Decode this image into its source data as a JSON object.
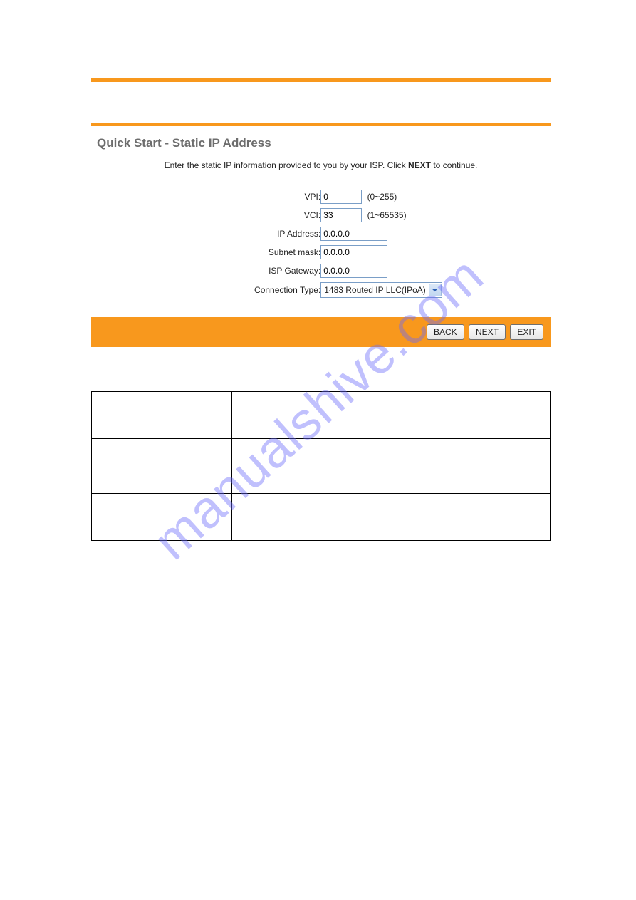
{
  "watermark": "manualshive.com",
  "panel": {
    "title": "Quick Start - Static IP Address",
    "desc_pre": "Enter the static IP information provided to you by your ISP. Click ",
    "desc_bold": "NEXT",
    "desc_post": " to continue."
  },
  "fields": {
    "vpi": {
      "label": "VPI:",
      "value": "0",
      "hint": "(0~255)"
    },
    "vci": {
      "label": "VCI:",
      "value": "33",
      "hint": "(1~65535)"
    },
    "ip": {
      "label": "IP Address:",
      "value": "0.0.0.0"
    },
    "mask": {
      "label": "Subnet mask:",
      "value": "0.0.0.0"
    },
    "gw": {
      "label": "ISP Gateway:",
      "value": "0.0.0.0"
    },
    "ct": {
      "label": "Connection Type:",
      "value": "1483 Routed IP LLC(IPoA)"
    }
  },
  "buttons": {
    "back": "BACK",
    "next": "NEXT",
    "exit": "EXIT"
  },
  "table": {
    "rows": [
      {
        "c1": "",
        "c2": ""
      },
      {
        "c1": "",
        "c2": ""
      },
      {
        "c1": "",
        "c2": ""
      },
      {
        "c1": "",
        "c2": "",
        "tall": true
      },
      {
        "c1": "",
        "c2": ""
      },
      {
        "c1": "",
        "c2": ""
      }
    ]
  }
}
